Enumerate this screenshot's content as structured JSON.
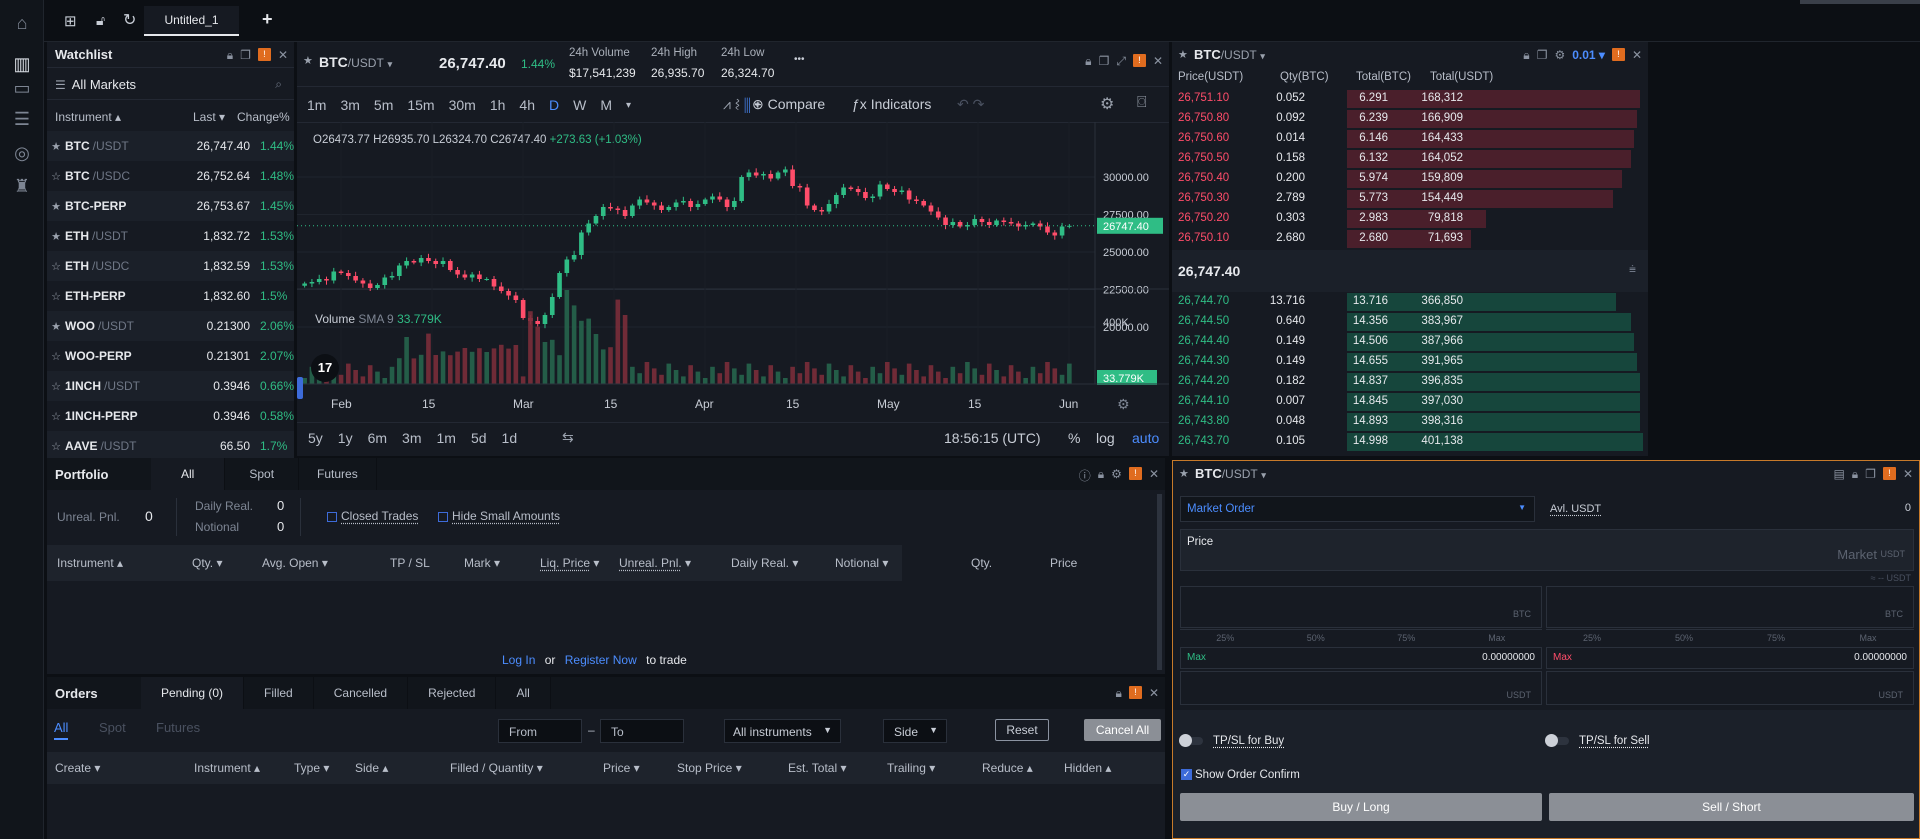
{
  "tabs": {
    "title": "Untitled_1",
    "add": "+"
  },
  "watchlist": {
    "title": "Watchlist",
    "market": "All Markets",
    "cols": {
      "instrument": "Instrument",
      "last": "Last",
      "change": "Change%"
    },
    "rows": [
      {
        "sym": "BTC",
        "quote": "/USDT",
        "last": "26,747.40",
        "chg": "1.44%",
        "star": "★"
      },
      {
        "sym": "BTC",
        "quote": "/USDC",
        "last": "26,752.64",
        "chg": "1.48%",
        "star": "☆"
      },
      {
        "sym": "BTC-PERP",
        "quote": "",
        "last": "26,753.67",
        "chg": "1.45%",
        "star": "★"
      },
      {
        "sym": "ETH",
        "quote": "/USDT",
        "last": "1,832.72",
        "chg": "1.53%",
        "star": "★"
      },
      {
        "sym": "ETH",
        "quote": "/USDC",
        "last": "1,832.59",
        "chg": "1.53%",
        "star": "☆"
      },
      {
        "sym": "ETH-PERP",
        "quote": "",
        "last": "1,832.60",
        "chg": "1.5%",
        "star": "☆"
      },
      {
        "sym": "WOO",
        "quote": "/USDT",
        "last": "0.21300",
        "chg": "2.06%",
        "star": "★"
      },
      {
        "sym": "WOO-PERP",
        "quote": "",
        "last": "0.21301",
        "chg": "2.07%",
        "star": "☆"
      },
      {
        "sym": "1INCH",
        "quote": "/USDT",
        "last": "0.3946",
        "chg": "0.66%",
        "star": "☆"
      },
      {
        "sym": "1INCH-PERP",
        "quote": "",
        "last": "0.3946",
        "chg": "0.58%",
        "star": "☆"
      },
      {
        "sym": "AAVE",
        "quote": "/USDT",
        "last": "66.50",
        "chg": "1.7%",
        "star": "☆"
      }
    ]
  },
  "chart": {
    "symbol": "BTC",
    "quote": "/USDT",
    "price": "26,747.40",
    "change": "1.44%",
    "vol_label": "24h Volume",
    "vol": "$17,541,239",
    "high_label": "24h High",
    "high": "26,935.70",
    "low_label": "24h Low",
    "low": "26,324.70",
    "more": "•••",
    "timeframes": [
      "1m",
      "3m",
      "5m",
      "15m",
      "30m",
      "1h",
      "4h",
      "D",
      "W",
      "M"
    ],
    "active_tf": "D",
    "compare": "Compare",
    "indicators": "Indicators",
    "ohlc": {
      "o": "O26473.77",
      "h": "H26935.70",
      "l": "L26324.70",
      "c": "C26747.40",
      "chg": "+273.63 (+1.03%)"
    },
    "vol_study": "Volume",
    "vol_sma": "SMA 9",
    "vol_value": "33.779K",
    "price_tag": "26747.40",
    "vol_tag": "33.779K",
    "ranges": [
      "5y",
      "1y",
      "6m",
      "3m",
      "1m",
      "5d",
      "1d"
    ],
    "time": "18:56:15 (UTC)",
    "pct": "%",
    "log": "log",
    "auto": "auto",
    "tv": "17"
  },
  "chart_data": {
    "type": "candlestick",
    "x_ticks": [
      "Feb",
      "15",
      "Mar",
      "15",
      "Apr",
      "15",
      "May",
      "15",
      "Jun"
    ],
    "y_ticks": [
      "30000.00",
      "27500.00",
      "25000.00",
      "22500.00",
      "20000.00"
    ],
    "vol_ticks": [
      "400K"
    ],
    "ylim": [
      19000,
      31000
    ],
    "closes": [
      22900,
      23000,
      23200,
      23100,
      23700,
      23600,
      23400,
      23100,
      22900,
      22600,
      22800,
      23300,
      23400,
      24100,
      24400,
      24300,
      24600,
      24400,
      24200,
      24400,
      23800,
      23500,
      23300,
      23500,
      23200,
      23200,
      22700,
      22400,
      22100,
      21800,
      20600,
      20400,
      20200,
      20800,
      22000,
      23600,
      24500,
      24800,
      26300,
      26900,
      27400,
      28000,
      27900,
      27800,
      27400,
      28100,
      28500,
      28300,
      28100,
      27800,
      28000,
      28300,
      28400,
      28000,
      28200,
      28500,
      28700,
      28500,
      28000,
      28400,
      30000,
      30300,
      30100,
      30200,
      29900,
      30300,
      30500,
      29400,
      29300,
      28100,
      27800,
      27700,
      28200,
      28800,
      29300,
      29200,
      29000,
      28600,
      28700,
      29500,
      29200,
      29000,
      29100,
      28500,
      28400,
      28100,
      27700,
      27300,
      26800,
      27000,
      26700,
      26800,
      27200,
      27000,
      26800,
      27100,
      27000,
      26900,
      26700,
      26800,
      26900,
      26700,
      26300,
      26100,
      26700,
      26747
    ]
  },
  "orderbook": {
    "symbol": "BTC",
    "quote": "/USDT",
    "step": "0.01",
    "cols": [
      "Price(USDT)",
      "Qty(BTC)",
      "Total(BTC)",
      "Total(USDT)"
    ],
    "asks": [
      [
        "26,751.10",
        "0.052",
        "6.291",
        "168,312",
        0.99
      ],
      [
        "26,750.80",
        "0.092",
        "6.239",
        "166,909",
        0.98
      ],
      [
        "26,750.60",
        "0.014",
        "6.146",
        "164,433",
        0.97
      ],
      [
        "26,750.50",
        "0.158",
        "6.132",
        "164,052",
        0.96
      ],
      [
        "26,750.40",
        "0.200",
        "5.974",
        "159,809",
        0.93
      ],
      [
        "26,750.30",
        "2.789",
        "5.773",
        "154,449",
        0.9
      ],
      [
        "26,750.20",
        "0.303",
        "2.983",
        "79,818",
        0.47
      ],
      [
        "26,750.10",
        "2.680",
        "2.680",
        "71,693",
        0.42
      ]
    ],
    "mid": "26,747.40",
    "bids": [
      [
        "26,744.70",
        "13.716",
        "13.716",
        "366,850",
        0.91
      ],
      [
        "26,744.50",
        "0.640",
        "14.356",
        "383,967",
        0.96
      ],
      [
        "26,744.40",
        "0.149",
        "14.506",
        "387,966",
        0.97
      ],
      [
        "26,744.30",
        "0.149",
        "14.655",
        "391,965",
        0.98
      ],
      [
        "26,744.20",
        "0.182",
        "14.837",
        "396,835",
        0.99
      ],
      [
        "26,744.10",
        "0.007",
        "14.845",
        "397,030",
        0.99
      ],
      [
        "26,743.80",
        "0.048",
        "14.893",
        "398,316",
        0.99
      ],
      [
        "26,743.70",
        "0.105",
        "14.998",
        "401,138",
        1.0
      ]
    ]
  },
  "portfolio": {
    "title": "Portfolio",
    "tabs": [
      "All",
      "Spot",
      "Futures"
    ],
    "unreal_label": "Unreal. Pnl.",
    "unreal": "0",
    "daily_label": "Daily Real.",
    "daily": "0",
    "notional_label": "Notional",
    "notional": "0",
    "closed": "Closed Trades",
    "hide_small": "Hide Small Amounts",
    "cols": [
      "Instrument",
      "Qty.",
      "Avg. Open",
      "TP / SL",
      "Mark",
      "Liq. Price",
      "Unreal. Pnl.",
      "Daily Real.",
      "Notional",
      "Qty.",
      "Price"
    ],
    "login": "Log In",
    "or": "or",
    "register": "Register Now",
    "to_trade": "to trade"
  },
  "orders": {
    "title": "Orders",
    "tabs": [
      "Pending (0)",
      "Filled",
      "Cancelled",
      "Rejected",
      "All"
    ],
    "subtabs": [
      "All",
      "Spot",
      "Futures"
    ],
    "from": "From",
    "dash": "–",
    "to": "To",
    "instruments": "All instruments",
    "side": "Side",
    "reset": "Reset",
    "cancel_all": "Cancel All",
    "cols": [
      "Create",
      "Instrument",
      "Type",
      "Side",
      "Filled / Quantity",
      "Price",
      "Stop Price",
      "Est. Total",
      "Trailing",
      "Reduce",
      "Hidden"
    ]
  },
  "trade": {
    "symbol": "BTC",
    "quote": "/USDT",
    "order_type": "Market Order",
    "avbl_label": "Avl. USDT",
    "avbl": "0",
    "price_label": "Price",
    "price_placeholder": "Market",
    "unit_usdt": "USDT",
    "approx": "≈ -- USDT",
    "unit_btc": "BTC",
    "pcts": [
      "25%",
      "50%",
      "75%",
      "Max"
    ],
    "max_label": "Max",
    "max_val": "0.00000000",
    "tpsl_buy": "TP/SL for Buy",
    "tpsl_sell": "TP/SL for Sell",
    "confirm": "Show Order Confirm",
    "buy": "Buy / Long",
    "sell": "Sell / Short"
  }
}
